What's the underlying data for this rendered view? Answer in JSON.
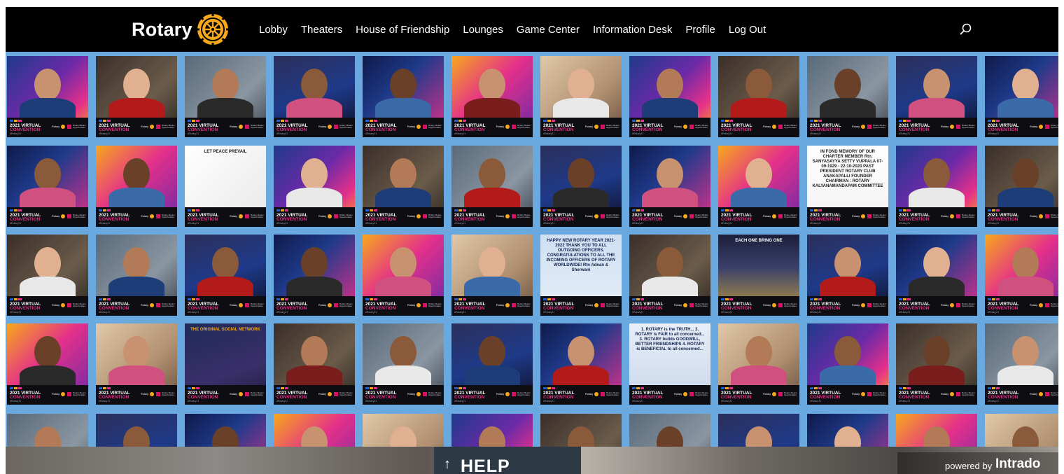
{
  "brand": {
    "name": "Rotary",
    "wheel_color": "#f7a81b"
  },
  "nav": {
    "items": [
      {
        "label": "Lobby"
      },
      {
        "label": "Theaters"
      },
      {
        "label": "House of Friendship"
      },
      {
        "label": "Lounges"
      },
      {
        "label": "Game Center"
      },
      {
        "label": "Information Desk"
      },
      {
        "label": "Profile"
      },
      {
        "label": "Log Out"
      }
    ],
    "search_icon": "search-icon"
  },
  "wall": {
    "frame_line1": "2021 VIRTUAL",
    "frame_line2": "CONVENTION",
    "frame_tag": "#Rotary21",
    "frame_brand": "Rotary",
    "frame_partner": "Rotary Means Opportunities",
    "special": {
      "peace": "LET PEACE PREVAIL",
      "memory": "IN FOND MEMORY OF OUR CHARTER MEMBER Rtn. SANYASAYYA SETTY VUPPALA 07-09-1929 - 22-10-2020 PAST PRESIDENT ROTARY CLUB ANAKAPALLI FOUNDER CHAIRMAN : ROTARY KALYANAMANDAPAM COMMITTEE",
      "newyear": "HAPPY NEW ROTARY YEAR 2021-2022 THANK YOU TO ALL OUTGOING OFFICERS. CONGRATULATIONS TO ALL THE INCOMING OFFICERS OF ROTARY WORLDWIDE! Rtn Adnan & Sherwani",
      "eachone": "EACH ONE BRING ONE",
      "original": "THE ORIGINAL SOCIAL NETWORK",
      "fourway": "1. ROTARY is the TRUTH... 2. ROTARY is FAIR to all concerned... 3. ROTARY builds GOODWILL, BETTER FRIENDSHIPS 4. ROTARY is BENEFICIAL to all concerned..."
    }
  },
  "footer": {
    "help_label": "HELP",
    "powered_by": "powered by",
    "powered_brand": "Intrado"
  }
}
